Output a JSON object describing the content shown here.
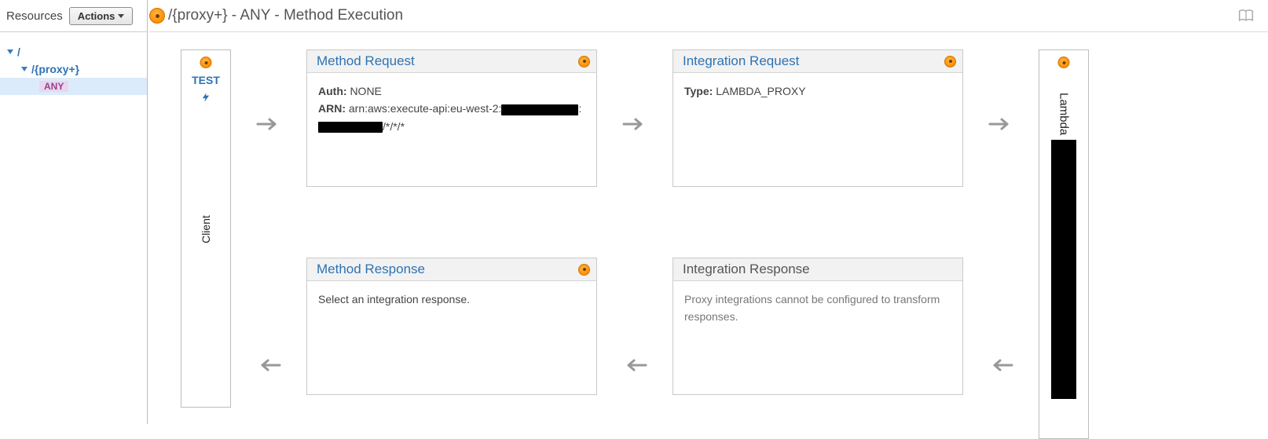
{
  "sidebar": {
    "title": "Resources",
    "actions_label": "Actions",
    "tree": {
      "root": "/",
      "proxy": "/{proxy+}",
      "method": "ANY"
    }
  },
  "header": {
    "title": "/{proxy+} - ANY - Method Execution"
  },
  "client_col": {
    "test": "TEST",
    "label": "Client"
  },
  "method_request": {
    "title": "Method Request",
    "auth_label": "Auth:",
    "auth_value": "NONE",
    "arn_label": "ARN:",
    "arn_prefix": "arn:aws:execute-api:eu-west-2:",
    "arn_mid": ":",
    "arn_suffix": "/*/*/*"
  },
  "integration_request": {
    "title": "Integration Request",
    "type_label": "Type:",
    "type_value": "LAMBDA_PROXY"
  },
  "method_response": {
    "title": "Method Response",
    "body": "Select an integration response."
  },
  "integration_response": {
    "title": "Integration Response",
    "body": "Proxy integrations cannot be configured to transform responses."
  },
  "lambda_col": {
    "title": "Lambda"
  }
}
